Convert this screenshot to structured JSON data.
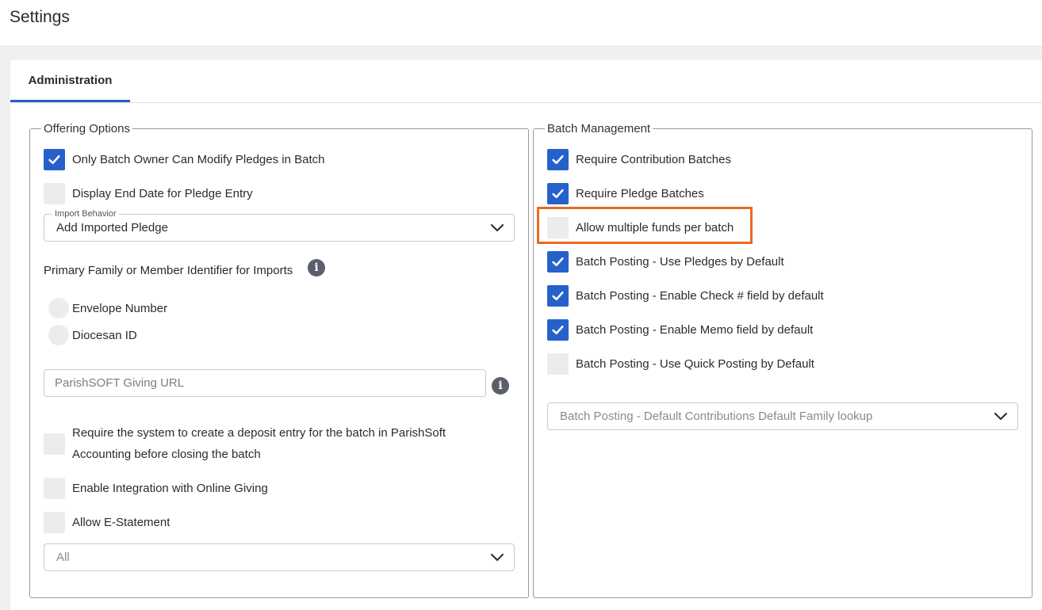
{
  "header": {
    "title": "Settings"
  },
  "tabs": [
    {
      "label": "Administration",
      "active": true
    }
  ],
  "offering_options": {
    "legend": "Offering Options",
    "only_batch_owner": {
      "label": "Only Batch Owner Can Modify Pledges in Batch",
      "checked": true
    },
    "display_end_date": {
      "label": "Display End Date for Pledge Entry",
      "checked": false
    },
    "import_behavior": {
      "label": "Import Behavior",
      "value": "Add Imported Pledge"
    },
    "primary_identifier": {
      "label": "Primary Family or Member Identifier for Imports",
      "options": [
        "Envelope Number",
        "Diocesan ID"
      ]
    },
    "giving_url": {
      "placeholder": "ParishSOFT Giving URL",
      "value": ""
    },
    "require_deposit": {
      "label": "Require the system to create a deposit entry for the batch in ParishSoft Accounting before closing the batch",
      "checked": false
    },
    "enable_online_giving": {
      "label": "Enable Integration with Online Giving",
      "checked": false
    },
    "allow_estatement": {
      "label": "Allow E-Statement",
      "checked": false
    },
    "estatement_select": {
      "value": "All"
    }
  },
  "batch_management": {
    "legend": "Batch Management",
    "items": [
      {
        "label": "Require Contribution Batches",
        "checked": true
      },
      {
        "label": "Require Pledge Batches",
        "checked": true
      },
      {
        "label": "Allow multiple funds per batch",
        "checked": false
      },
      {
        "label": "Batch Posting - Use Pledges by Default",
        "checked": true
      },
      {
        "label": "Batch Posting - Enable Check # field by default",
        "checked": true
      },
      {
        "label": "Batch Posting - Enable Memo field by default",
        "checked": true
      },
      {
        "label": "Batch Posting - Use Quick Posting by Default",
        "checked": false
      }
    ],
    "family_lookup_select": {
      "value": "Batch Posting - Default Contributions Default Family lookup"
    }
  },
  "colors": {
    "accent": "#2561c9",
    "highlight": "#ec6a1f",
    "checkbox_empty": "#ececee"
  },
  "icons": {
    "check": "check-icon",
    "info": "info-icon",
    "chevron": "chevron-down-icon"
  }
}
